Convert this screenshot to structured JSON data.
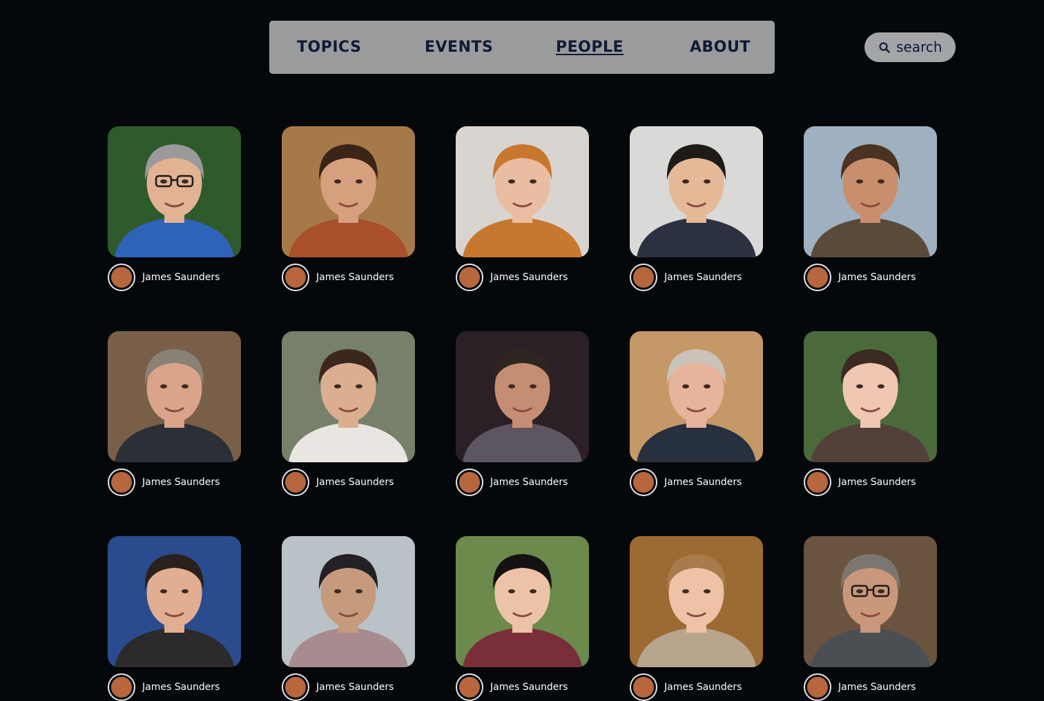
{
  "nav": {
    "items": [
      {
        "label": "TOPICS",
        "active": false
      },
      {
        "label": "EVENTS",
        "active": false
      },
      {
        "label": "PEOPLE",
        "active": true
      },
      {
        "label": "ABOUT",
        "active": false
      }
    ]
  },
  "search": {
    "label": "search",
    "icon": "search-icon"
  },
  "colors": {
    "background": "#05080b",
    "nav_background": "#9a9b9d",
    "nav_text": "#0f1b33",
    "badge": "#b8663e"
  },
  "people": [
    {
      "name": "James Saunders",
      "photo": {
        "bg": "#2f5a2c",
        "skin": "#e2b293",
        "hair": "#9a9a9a",
        "shirt": "#2f63b8",
        "glasses": true
      }
    },
    {
      "name": "James Saunders",
      "photo": {
        "bg": "#a57a48",
        "skin": "#d6a07e",
        "hair": "#3b2418",
        "shirt": "#a9502c",
        "glasses": false
      }
    },
    {
      "name": "James Saunders",
      "photo": {
        "bg": "#d8d4cf",
        "skin": "#e9bda1",
        "hair": "#c8772f",
        "shirt": "#c8772f",
        "glasses": false
      }
    },
    {
      "name": "James Saunders",
      "photo": {
        "bg": "#d9d9d7",
        "skin": "#e5b898",
        "hair": "#1d1a18",
        "shirt": "#2c3140",
        "glasses": false
      }
    },
    {
      "name": "James Saunders",
      "photo": {
        "bg": "#9fb0c0",
        "skin": "#c98f6c",
        "hair": "#4a3322",
        "shirt": "#5b4a3a",
        "glasses": false
      }
    },
    {
      "name": "James Saunders",
      "photo": {
        "bg": "#7a5f48",
        "skin": "#d9a489",
        "hair": "#8a8276",
        "shirt": "#2b2f36",
        "glasses": false
      }
    },
    {
      "name": "James Saunders",
      "photo": {
        "bg": "#76806a",
        "skin": "#dcae90",
        "hair": "#3c271c",
        "shirt": "#e9e6e1",
        "glasses": false
      }
    },
    {
      "name": "James Saunders",
      "photo": {
        "bg": "#2a2026",
        "skin": "#c58d72",
        "hair": "#2e2520",
        "shirt": "#5d5560",
        "glasses": false
      }
    },
    {
      "name": "James Saunders",
      "photo": {
        "bg": "#c49867",
        "skin": "#e7b39b",
        "hair": "#c9c3b9",
        "shirt": "#27303f",
        "glasses": false
      }
    },
    {
      "name": "James Saunders",
      "photo": {
        "bg": "#4a6a3c",
        "skin": "#f0c7b3",
        "hair": "#3d2a22",
        "shirt": "#53403a",
        "glasses": false
      }
    },
    {
      "name": "James Saunders",
      "photo": {
        "bg": "#2a4c8e",
        "skin": "#e2ae91",
        "hair": "#2a211c",
        "shirt": "#2c2a2a",
        "glasses": false
      }
    },
    {
      "name": "James Saunders",
      "photo": {
        "bg": "#b9c2c7",
        "skin": "#c69a7d",
        "hair": "#232125",
        "shirt": "#a78b8f",
        "glasses": false
      }
    },
    {
      "name": "James Saunders",
      "photo": {
        "bg": "#6b8a4c",
        "skin": "#ecc3a9",
        "hair": "#141112",
        "shirt": "#7a2e3a",
        "glasses": false
      }
    },
    {
      "name": "James Saunders",
      "photo": {
        "bg": "#9c6a33",
        "skin": "#edc2a6",
        "hair": "#a87b4a",
        "shirt": "#b8a58d",
        "glasses": false
      }
    },
    {
      "name": "James Saunders",
      "photo": {
        "bg": "#6a5440",
        "skin": "#c9977a",
        "hair": "#7b7770",
        "shirt": "#4b4f53",
        "glasses": true
      }
    }
  ]
}
